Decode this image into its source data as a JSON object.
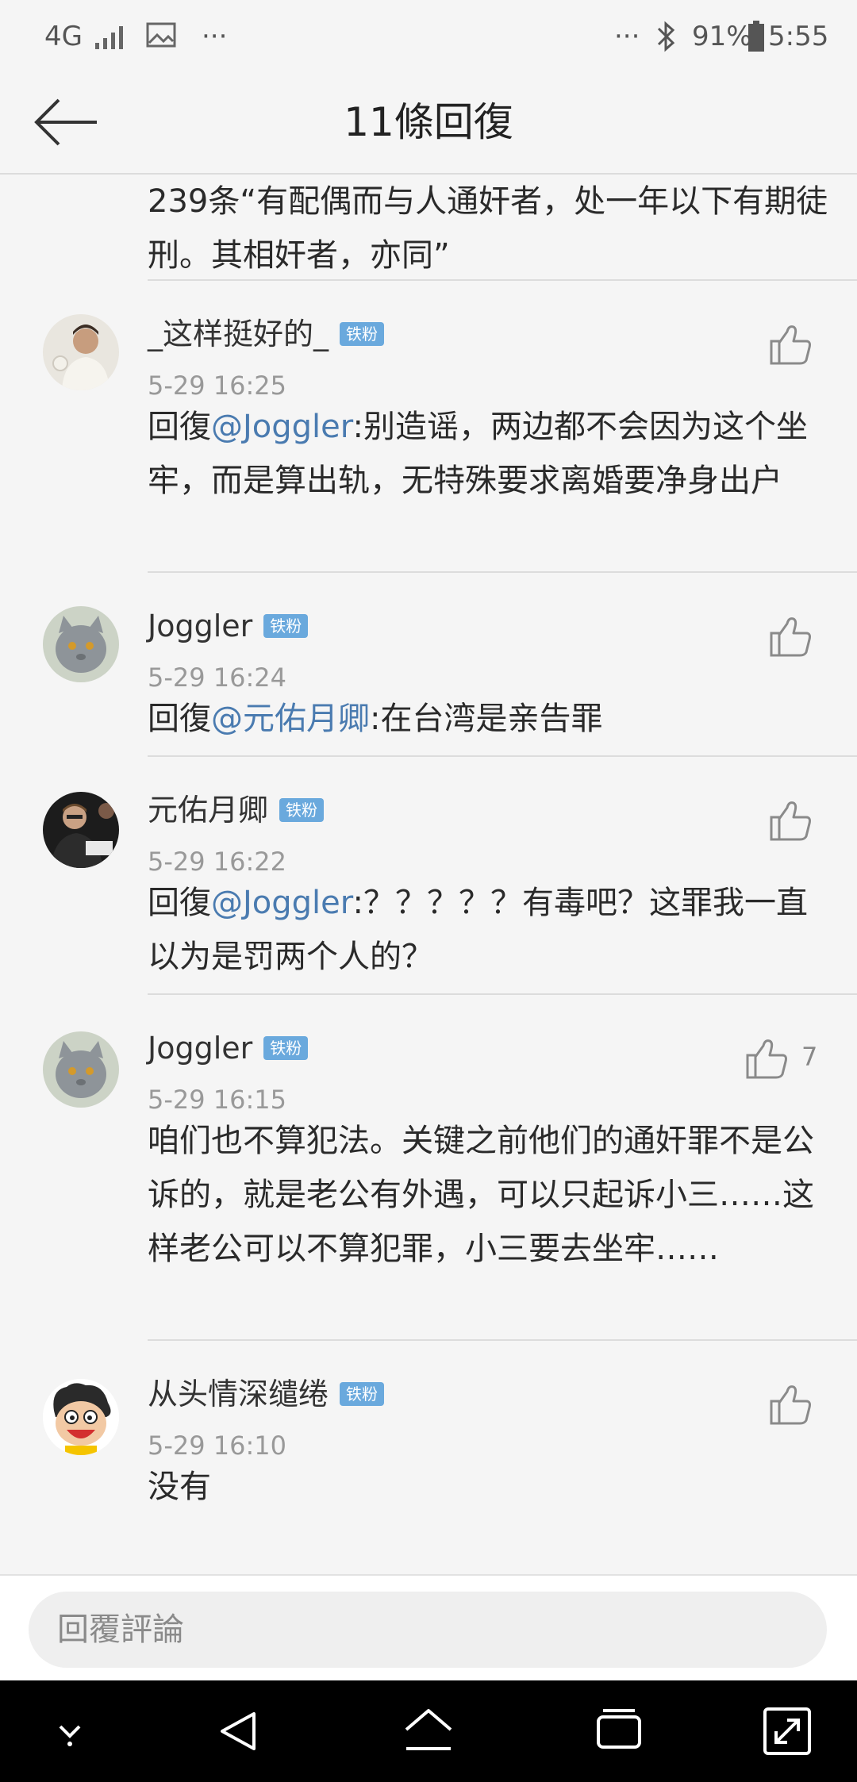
{
  "status_bar": {
    "network": "4G",
    "left_dots": "···",
    "right_dots": "···",
    "battery": "91%",
    "time": "5:55"
  },
  "header": {
    "title": "11條回復"
  },
  "carryover_text": "239条“有配偶而与人通奸者，处一年以下有期徒刑。其相奸者，亦同”",
  "comments": [
    {
      "user": "_这样挺好的_",
      "badge": "铁粉",
      "time": "5-29 16:25",
      "prefix": "回復",
      "mention": "@Joggler",
      "text": ":别造谣，两边都不会因为这个坐牢，而是算出轨，无特殊要求离婚要净身出户"
    },
    {
      "user": "Joggler",
      "badge": "铁粉",
      "time": "5-29 16:24",
      "prefix": "回復",
      "mention": "@元佑月卿",
      "text": ":在台湾是亲告罪"
    },
    {
      "user": "元佑月卿",
      "badge": "铁粉",
      "time": "5-29 16:22",
      "prefix": "回復",
      "mention": "@Joggler",
      "text": ":？？？？？有毒吧？这罪我一直以为是罚两个人的？"
    },
    {
      "user": "Joggler",
      "badge": "铁粉",
      "time": "5-29 16:15",
      "like_count": "7",
      "text": "咱们也不算犯法。关键之前他们的通奸罪不是公诉的，就是老公有外遇，可以只起诉小三……这样老公可以不算犯罪，小三要去坐牢……"
    },
    {
      "user": "从头情深缱绻",
      "badge": "铁粉",
      "time": "5-29 16:10",
      "text": "没有"
    }
  ],
  "reply": {
    "placeholder": "回覆評論"
  },
  "colors": {
    "mention": "#4a7bb0",
    "badge": "#6aa9dd",
    "background": "#f5f5f5"
  },
  "icons": [
    "back-arrow-icon",
    "thumbs-up-icon",
    "bluetooth-icon",
    "battery-icon",
    "signal-icon",
    "image-icon"
  ]
}
